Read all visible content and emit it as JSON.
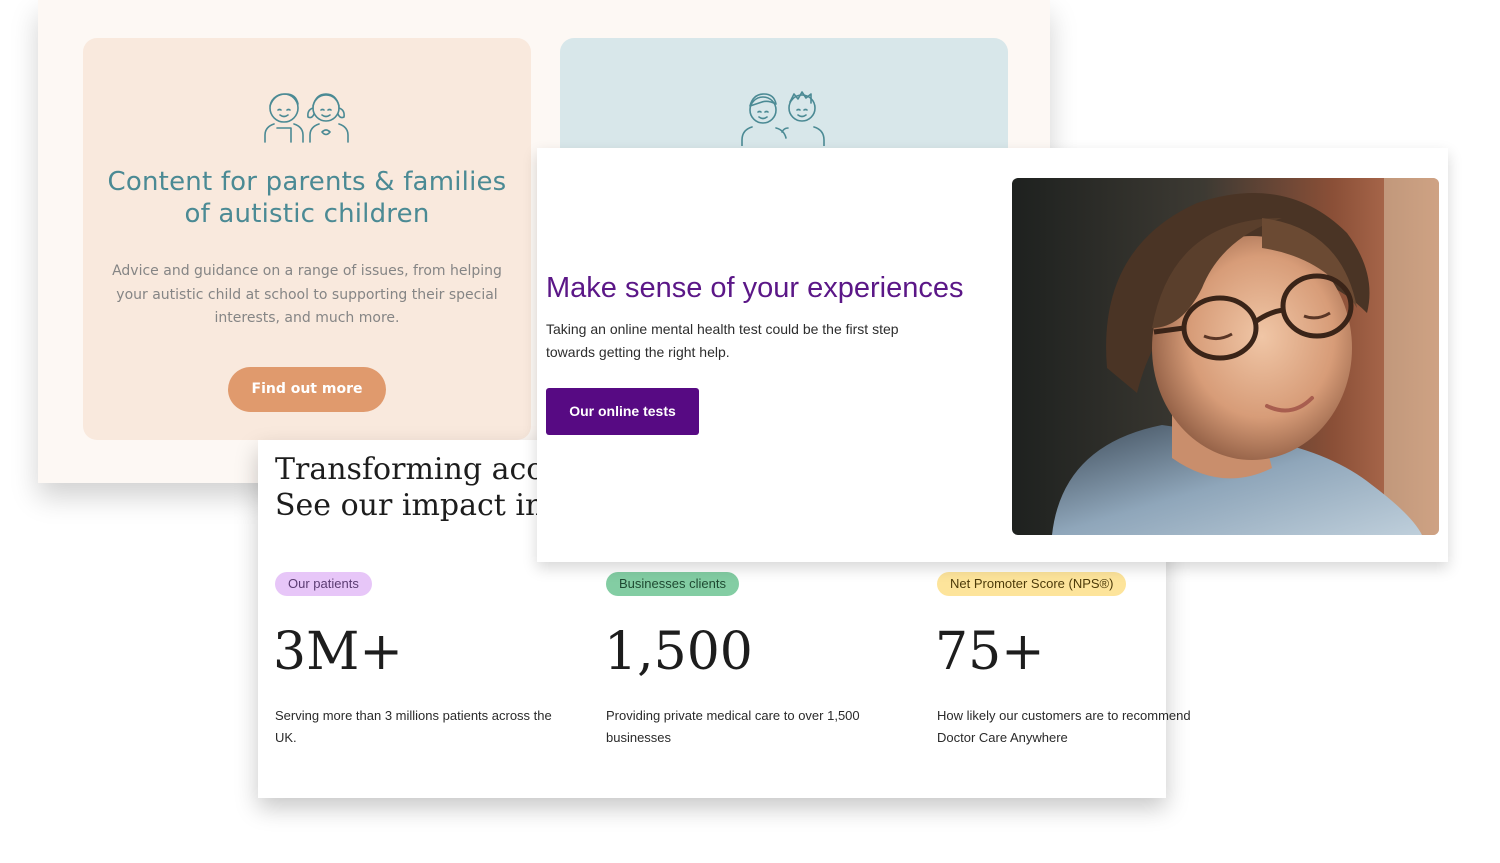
{
  "autism_panel": {
    "parents_card": {
      "icon": "children-icon",
      "title": "Content for parents & families of autistic children",
      "description": "Advice and guidance on a range of issues, from helping your autistic child at school to supporting their special interests, and much more.",
      "button_label": "Find out more"
    },
    "adults_card": {
      "icon": "two-people-icon"
    },
    "colors": {
      "parents_bg": "#f9e9dd",
      "adults_bg": "#d8e7ea",
      "title": "#4b8a94",
      "button": "#e09a6d"
    }
  },
  "mental_panel": {
    "title": "Make sense of your experiences",
    "text": "Taking an online mental health test could be the first step towards getting the right help.",
    "button_label": "Our online tests",
    "photo": "smiling-woman-with-glasses-photo",
    "colors": {
      "title": "#5b1787",
      "button": "#570a83"
    }
  },
  "impact_panel": {
    "heading_line1": "Transforming acces",
    "heading_line2": "See our impact in nu",
    "stats": [
      {
        "badge": "Our patients",
        "value": "3M+",
        "description": "Serving more than 3 millions patients across the UK.",
        "badge_color": "#e7c6f8"
      },
      {
        "badge": "Businesses clients",
        "value": "1,500",
        "description": "Providing private medical care to over 1,500 businesses",
        "badge_color": "#83cda3"
      },
      {
        "badge": "Net Promoter Score (NPS®)",
        "value": "75+",
        "description": "How likely our customers are to recommend Doctor Care Anywhere",
        "badge_color": "#fde49b"
      }
    ]
  }
}
